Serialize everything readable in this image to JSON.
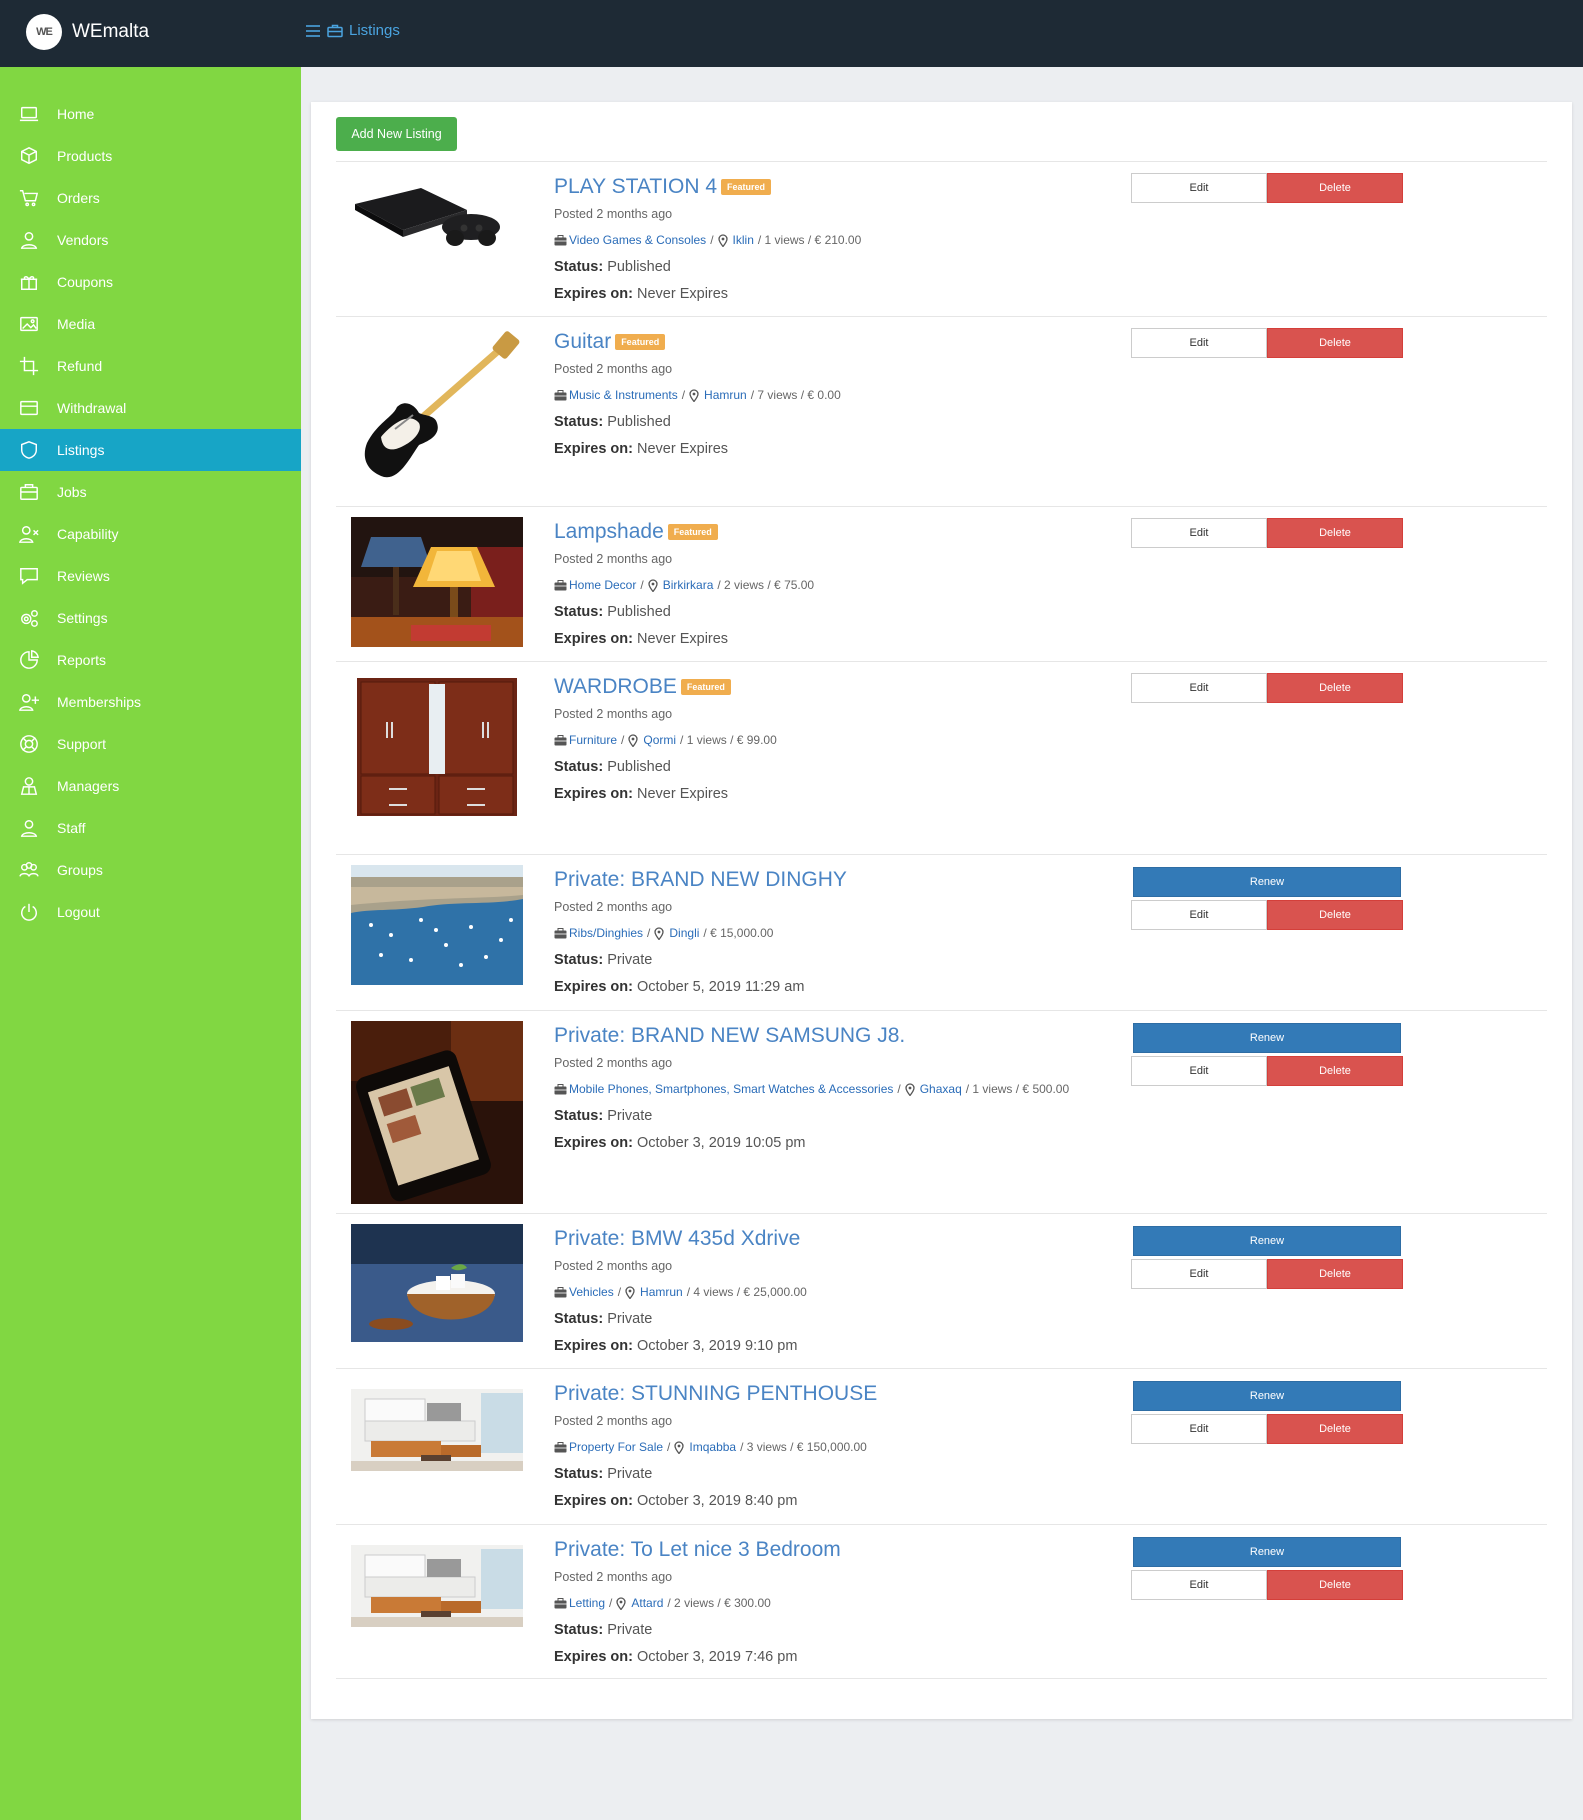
{
  "app": {
    "name": "WEmalta",
    "logo_text": "WE"
  },
  "header": {
    "crumb": "Listings"
  },
  "sidebar": {
    "items": [
      {
        "label": "Home",
        "icon": "monitor-icon"
      },
      {
        "label": "Products",
        "icon": "cube-icon"
      },
      {
        "label": "Orders",
        "icon": "cart-icon"
      },
      {
        "label": "Vendors",
        "icon": "user-icon"
      },
      {
        "label": "Coupons",
        "icon": "gift-icon"
      },
      {
        "label": "Media",
        "icon": "image-icon"
      },
      {
        "label": "Refund",
        "icon": "crop-icon"
      },
      {
        "label": "Withdrawal",
        "icon": "card-icon"
      },
      {
        "label": "Listings",
        "icon": "shield-icon",
        "active": true
      },
      {
        "label": "Jobs",
        "icon": "briefcase-icon"
      },
      {
        "label": "Capability",
        "icon": "user-x-icon"
      },
      {
        "label": "Reviews",
        "icon": "comment-icon"
      },
      {
        "label": "Settings",
        "icon": "gears-icon"
      },
      {
        "label": "Reports",
        "icon": "pie-icon"
      },
      {
        "label": "Memberships",
        "icon": "user-plus-icon"
      },
      {
        "label": "Support",
        "icon": "lifebuoy-icon"
      },
      {
        "label": "Managers",
        "icon": "manager-icon"
      },
      {
        "label": "Staff",
        "icon": "user-icon"
      },
      {
        "label": "Groups",
        "icon": "users-icon"
      },
      {
        "label": "Logout",
        "icon": "power-icon"
      }
    ]
  },
  "main": {
    "add_button": "Add New Listing",
    "labels": {
      "status": "Status:",
      "expires": "Expires on:",
      "edit": "Edit",
      "delete": "Delete",
      "renew": "Renew",
      "featured": "Featured"
    },
    "listings": [
      {
        "title": "PLAY STATION 4",
        "featured": true,
        "posted": "Posted 2 months ago",
        "category": "Video Games & Consoles",
        "location": "Iklin",
        "stats": "/ 1 views / € 210.00",
        "status": "Published",
        "expires": "Never Expires",
        "renew": false,
        "image": "playstation"
      },
      {
        "title": "Guitar",
        "featured": true,
        "posted": "Posted 2 months ago",
        "category": "Music & Instruments",
        "location": "Hamrun",
        "stats": "/ 7 views / € 0.00",
        "status": "Published",
        "expires": "Never Expires",
        "renew": false,
        "image": "guitar"
      },
      {
        "title": "Lampshade",
        "featured": true,
        "posted": "Posted 2 months ago",
        "category": "Home Decor",
        "location": "Birkirkara",
        "stats": "/ 2 views / € 75.00",
        "status": "Published",
        "expires": "Never Expires",
        "renew": false,
        "image": "lamp"
      },
      {
        "title": "WARDROBE",
        "featured": true,
        "posted": "Posted 2 months ago",
        "category": "Furniture",
        "location": "Qormi",
        "stats": "/ 1 views / € 99.00",
        "status": "Published",
        "expires": "Never Expires",
        "renew": false,
        "image": "wardrobe"
      },
      {
        "title": "Private: BRAND NEW DINGHY",
        "featured": false,
        "posted": "Posted 2 months ago",
        "category": "Ribs/Dinghies",
        "location": "Dingli",
        "stats": "/ € 15,000.00",
        "status": "Private",
        "expires": "October 5, 2019 11:29 am",
        "renew": true,
        "image": "harbour"
      },
      {
        "title": "Private: BRAND NEW SAMSUNG J8.",
        "featured": false,
        "posted": "Posted 2 months ago",
        "category": "Mobile Phones, Smartphones, Smart Watches & Accessories",
        "location": "Ghaxaq",
        "stats": "/ 1 views / € 500.00",
        "status": "Private",
        "expires": "October 3, 2019 10:05 pm",
        "renew": true,
        "image": "phone"
      },
      {
        "title": "Private: BMW 435d Xdrive",
        "featured": false,
        "posted": "Posted 2 months ago",
        "category": "Vehicles",
        "location": "Hamrun",
        "stats": "/ 4 views / € 25,000.00",
        "status": "Private",
        "expires": "October 3, 2019 9:10 pm",
        "renew": true,
        "image": "bowl"
      },
      {
        "title": "Private: STUNNING PENTHOUSE",
        "featured": false,
        "posted": "Posted 2 months ago",
        "category": "Property For Sale",
        "location": "Imqabba",
        "stats": "/ 3 views / € 150,000.00",
        "status": "Private",
        "expires": "October 3, 2019 8:40 pm",
        "renew": true,
        "image": "room"
      },
      {
        "title": "Private: To Let nice 3 Bedroom",
        "featured": false,
        "posted": "Posted 2 months ago",
        "category": "Letting",
        "location": "Attard",
        "stats": "/ 2 views / € 300.00",
        "status": "Private",
        "expires": "October 3, 2019 7:46 pm",
        "renew": true,
        "image": "room"
      }
    ]
  },
  "colors": {
    "topbar": "#1e2a35",
    "sidebar": "#81d742",
    "active": "#17a5c6",
    "link": "#4a84c4",
    "delete": "#d9534f",
    "renew": "#337ab7",
    "add": "#4cae4c",
    "featured": "#f0ad4e"
  }
}
